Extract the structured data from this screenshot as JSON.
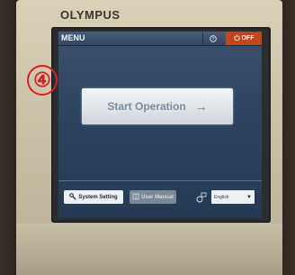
{
  "brand": "OLYMPUS",
  "annotation_marker": "④",
  "topbar": {
    "title": "MENU",
    "help_icon": "help-icon",
    "off_label": "OFF",
    "off_icon": "power-icon"
  },
  "main": {
    "start_label": "Start Operation",
    "start_arrow": "→"
  },
  "bottom": {
    "system_setting_label": "System Setting",
    "user_manual_label": "User Manual",
    "language_value": "English",
    "language_caret": "▼"
  },
  "colors": {
    "off_button": "#c2461c",
    "marker": "#d62020",
    "screen": "#2e445e"
  }
}
